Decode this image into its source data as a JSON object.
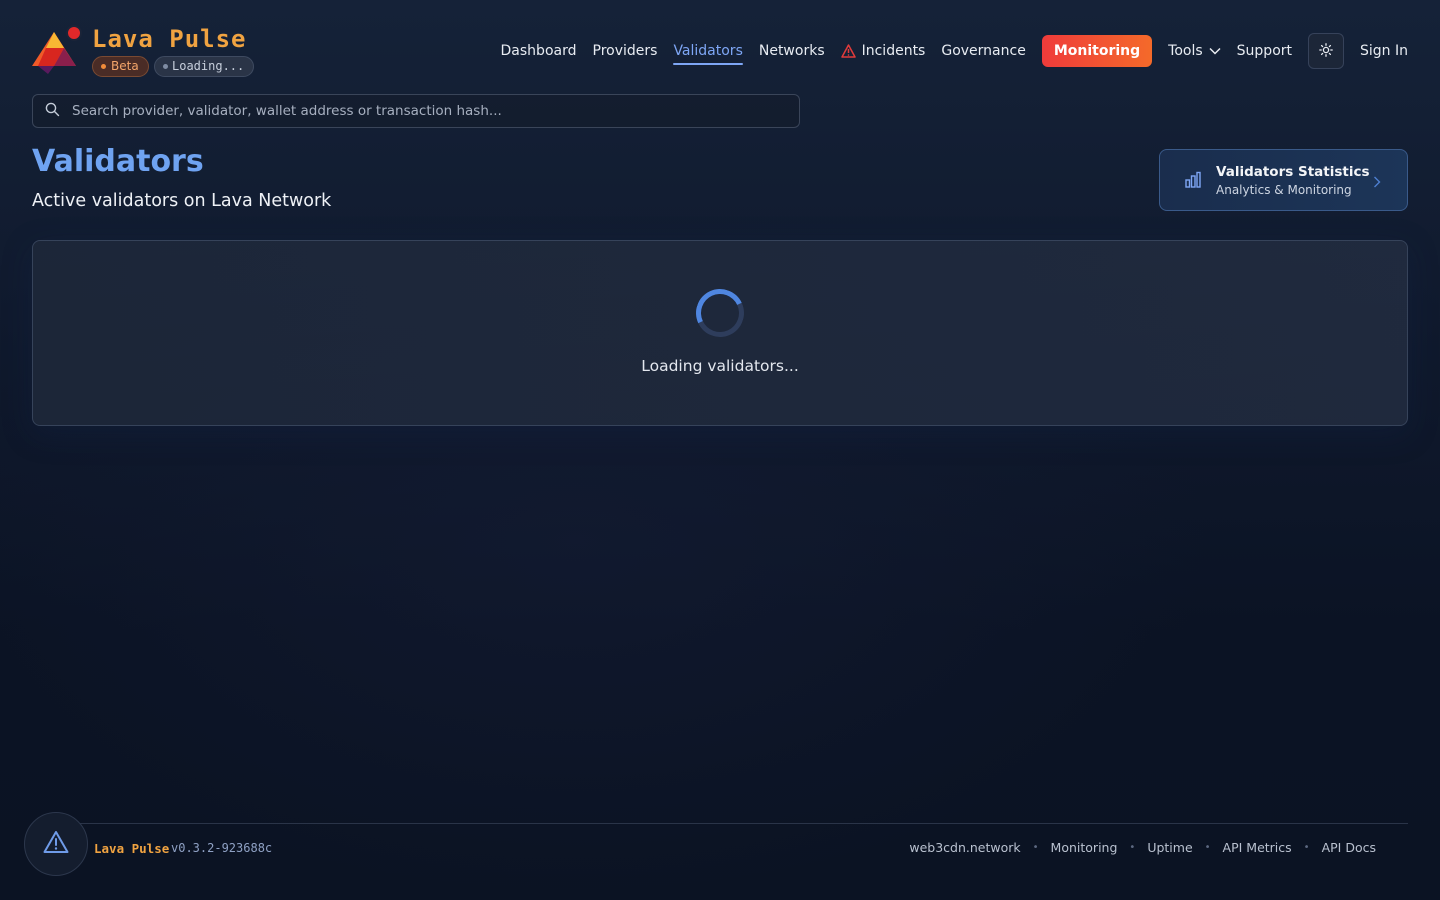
{
  "header": {
    "brand": "Lava Pulse",
    "beta_badge": "Beta",
    "status_badge": "Loading...",
    "nav": {
      "dashboard": "Dashboard",
      "providers": "Providers",
      "validators": "Validators",
      "networks": "Networks",
      "incidents": "Incidents",
      "governance": "Governance",
      "monitoring": "Monitoring",
      "tools": "Tools",
      "support": "Support",
      "sign_in": "Sign In"
    },
    "active_nav": "Validators"
  },
  "search": {
    "placeholder": "Search provider, validator, wallet address or transaction hash..."
  },
  "page": {
    "title": "Validators",
    "subtitle": "Active validators on Lava Network"
  },
  "stats_card": {
    "title": "Validators Statistics",
    "subtitle": "Analytics & Monitoring"
  },
  "loading": {
    "text": "Loading validators..."
  },
  "footer": {
    "brand": "Lava Pulse",
    "version": "v0.3.2-923688c",
    "links": [
      "web3cdn.network",
      "Monitoring",
      "Uptime",
      "API Metrics",
      "API Docs"
    ]
  },
  "colors": {
    "accent": "#6fa3f1",
    "brand": "#f0a341",
    "monitoring_start": "#ef3b3b",
    "monitoring_end": "#f46a2a"
  },
  "icons": {
    "logo": "lava-logo",
    "incidents": "warning-triangle-icon",
    "tools": "chevron-down-icon",
    "theme": "sun-icon",
    "search": "search-icon",
    "stats": "bar-chart-icon",
    "stats_chevron": "chevron-right-icon",
    "alert": "alert-triangle-icon"
  }
}
